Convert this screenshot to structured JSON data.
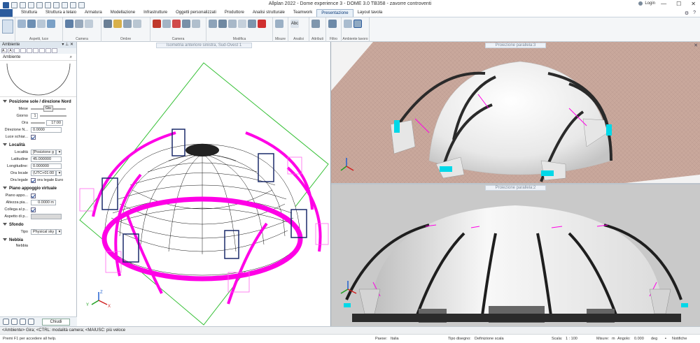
{
  "window": {
    "title": "Allplan 2022 - Dome experience 3 - DOME 3.0 TB358 - zavorre controventi",
    "login": "Login",
    "controls": [
      "—",
      "☐",
      "✕"
    ]
  },
  "menu": {
    "tabs": [
      "Struttura",
      "Struttura a telaio",
      "Armatura",
      "Modellazione",
      "Infrastrutture",
      "Oggetti personalizzati",
      "Produttore",
      "Analisi strutturale",
      "Teamwork",
      "Presentazione",
      "Layout tavola"
    ],
    "active_tab": "Presentazione"
  },
  "ribbon": {
    "groups": [
      "Aspetti, luce",
      "Camera",
      "Ombre",
      "Camera",
      "Modifica",
      "Misure",
      "Analisi",
      "Attributi",
      "Filtro",
      "Ambiente lavoro"
    ]
  },
  "panel": {
    "header": "Ambiente",
    "tabs": [
      "A..",
      "A",
      "",
      "",
      "",
      "",
      "",
      "",
      ""
    ],
    "title": "Ambiente",
    "sections": {
      "sun": "Posizione sole / direzione Nord",
      "location": "Località",
      "plane": "Piano appoggio virtuale",
      "background": "Sfondo",
      "fog": "Nebbia"
    },
    "fields": {
      "mese_label": "Mese",
      "mese_value": "Giu",
      "giorno_label": "Giorno",
      "giorno_value": "1",
      "ora_label": "Ora",
      "ora_value": "17:00",
      "direzione_label": "Direzione N...",
      "direzione_value": "0.0000",
      "luce_label": "Luce schiar...",
      "localita_label": "Località",
      "localita_value": "[Posizione g",
      "latitudine_label": "Latitudine",
      "latitudine_value": "45.000000",
      "longitudine_label": "Longitudine:",
      "longitudine_value": "0.000000",
      "oralocale_label": "Ora locale",
      "oralocale_value": "(UTC+01:00",
      "oralegale_label": "Ora legale",
      "oralegale_value": "ora legale Euro",
      "pianoapp_label": "Piano appo...",
      "altezza_label": "Altezza pia...",
      "altezza_value": "0.0000 m",
      "collega_label": "Collega al p...",
      "aspetto_label": "Aspetto di p...",
      "tipo_label": "Tipo",
      "tipo_value": "Physical sky",
      "nebbia_label": "Nebbia"
    },
    "close_button": "Chiudi"
  },
  "viewports": {
    "left_label": "Isometria anteriore sinistra, Sud-Ovest 1",
    "top_right_label": "Proiezione parallela:3",
    "bottom_right_label": "Proiezione parallela:2"
  },
  "command_line": "<Ambiente> Gira; <CTRL: modalità camera; <MAIUSC: più veloce",
  "status": {
    "help": "Premi F1 per accedere all help.",
    "paese_label": "Paese:",
    "paese_value": "Italia",
    "tipo_label": "Tipo disegno:",
    "tipo_value": "Definizione scala",
    "scala_label": "Scala:",
    "scala_value": "1 : 100",
    "misure_label": "Misure:",
    "misure_value": "m",
    "angolo_label": "Angolo:",
    "angolo_value": "0.000",
    "deg_value": "deg",
    "notifiche": "Notifiche"
  },
  "colors": {
    "accent": "#2b5b9c",
    "magenta": "#ff00e6",
    "ground_grid": "#00c000",
    "dome_white": "#f5f5f5",
    "ground_tiles": "#c9a89c",
    "cyan": "#00d8e8"
  },
  "icons": [
    "save-icon",
    "undo-icon",
    "redo-icon",
    "help-icon",
    "gear-icon",
    "close-icon",
    "search-icon",
    "pin-icon",
    "axis-triad-icon",
    "notification-icon"
  ]
}
